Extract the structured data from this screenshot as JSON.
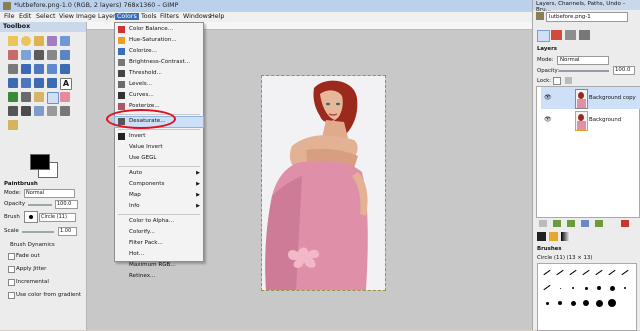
{
  "window": {
    "title": "*lutbefore.png-1.0 (RGB, 2 layers) 768x1360 – GIMP"
  },
  "menubar": {
    "items": [
      "File",
      "Edit",
      "Select",
      "View",
      "Image",
      "Layer",
      "Colors",
      "Tools",
      "Filters",
      "Windows",
      "Help"
    ]
  },
  "toolbox": {
    "title": "Toolbox",
    "tool_options_title": "Paintbrush",
    "mode_label": "Mode:",
    "mode_value": "Normal",
    "opacity_label": "Opacity",
    "opacity_value": "100.0",
    "brush_label": "Brush",
    "brush_value": "Circle (11)",
    "scale_label": "Scale",
    "scale_value": "1.00",
    "brush_dynamics_label": "Brush Dynamics",
    "fade_out_label": "Fade out",
    "apply_jitter_label": "Apply Jitter",
    "incremental_label": "Incremental",
    "use_gradient_label": "Use color from gradient"
  },
  "colors_menu": {
    "items": [
      {
        "label": "Color Balance...",
        "icon": "color-balance-icon"
      },
      {
        "label": "Hue-Saturation...",
        "icon": "hue-saturation-icon"
      },
      {
        "label": "Colorize...",
        "icon": "colorize-icon"
      },
      {
        "label": "Brightness-Contrast...",
        "icon": "brightness-contrast-icon"
      },
      {
        "label": "Threshold...",
        "icon": "threshold-icon"
      },
      {
        "label": "Levels...",
        "icon": "levels-icon"
      },
      {
        "label": "Curves...",
        "icon": "curves-icon"
      },
      {
        "label": "Posterize...",
        "icon": "posterize-icon"
      },
      {
        "label": "Desaturate...",
        "icon": "desaturate-icon"
      },
      {
        "label": "Invert",
        "icon": "invert-icon"
      },
      {
        "label": "Value Invert",
        "icon": ""
      },
      {
        "label": "Use GEGL",
        "icon": ""
      },
      {
        "label": "Auto",
        "icon": "",
        "submenu": true
      },
      {
        "label": "Components",
        "icon": "",
        "submenu": true
      },
      {
        "label": "Map",
        "icon": "",
        "submenu": true
      },
      {
        "label": "Info",
        "icon": "",
        "submenu": true
      },
      {
        "label": "Color to Alpha...",
        "icon": ""
      },
      {
        "label": "Colorify...",
        "icon": ""
      },
      {
        "label": "Filter Pack...",
        "icon": ""
      },
      {
        "label": "Hot...",
        "icon": ""
      },
      {
        "label": "Maximum RGB...",
        "icon": ""
      },
      {
        "label": "Retinex...",
        "icon": ""
      }
    ],
    "highlighted": "Desaturate..."
  },
  "dock": {
    "title": "Layers, Channels, Paths, Undo – Bru...",
    "image_selector": "lutbefore.png-1",
    "layers_label": "Layers",
    "mode_label": "Mode:",
    "mode_value": "Normal",
    "opacity_label": "Opacity:",
    "opacity_value": "100.0",
    "lock_label": "Lock:",
    "layers": [
      {
        "name": "Background copy"
      },
      {
        "name": "Background"
      }
    ],
    "brushes_label": "Brushes",
    "brush_info": "Circle (11) (13 × 13)"
  },
  "colors": {
    "accent": "#3a6fb5",
    "highlight_oval": "#e01020",
    "fg_color": "#000000",
    "bg_color": "#ffffff"
  }
}
